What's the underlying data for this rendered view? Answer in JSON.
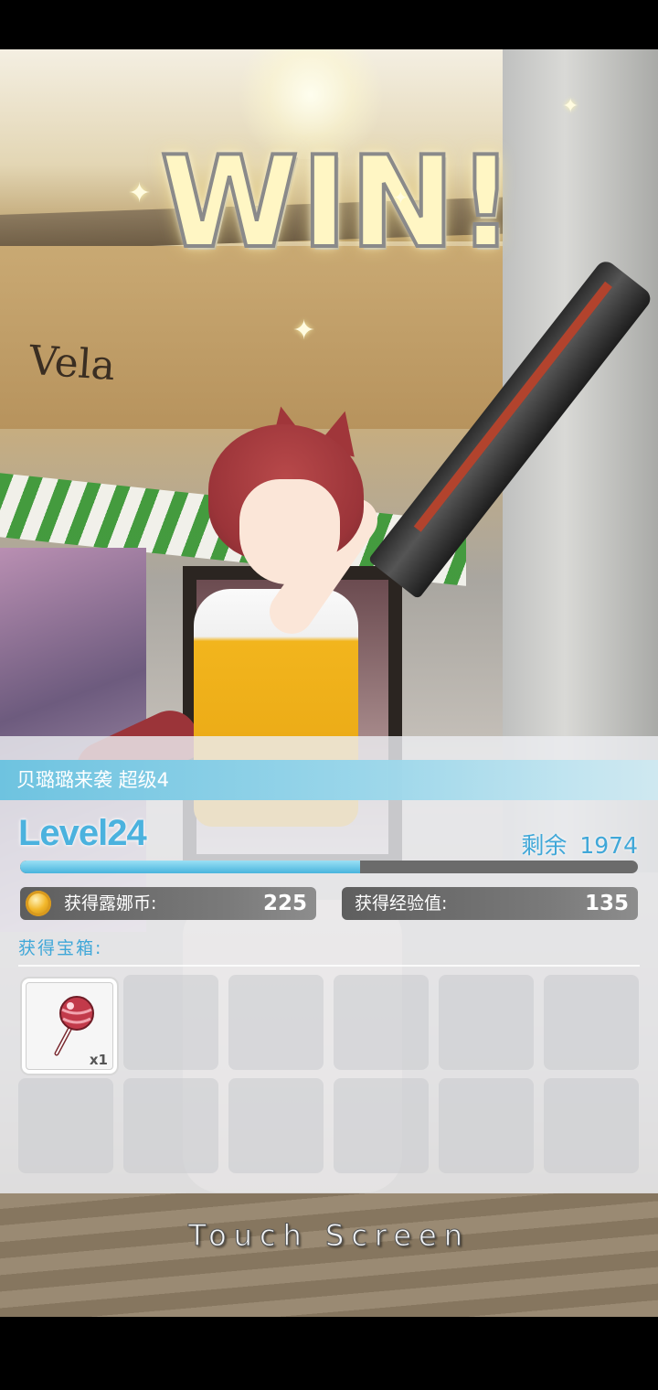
{
  "scene": {
    "win_text": "WIN!",
    "store_sign": "Vela"
  },
  "result": {
    "stage_title": "贝璐璐来袭 超级4",
    "level": "Level24",
    "remaining_label": "剩余",
    "remaining_value": "1974",
    "exp_progress": 0.55,
    "coins_label": "获得露娜币:",
    "coins_value": "225",
    "exp_label": "获得经验值:",
    "exp_value": "135",
    "chest_label": "获得宝箱:",
    "slots": [
      {
        "filled": true,
        "icon": "lollipop-icon",
        "qty": "x1"
      },
      {
        "filled": false
      },
      {
        "filled": false
      },
      {
        "filled": false
      },
      {
        "filled": false
      },
      {
        "filled": false
      },
      {
        "filled": false
      },
      {
        "filled": false
      },
      {
        "filled": false
      },
      {
        "filled": false
      },
      {
        "filled": false
      },
      {
        "filled": false
      }
    ]
  },
  "prompt": {
    "touch_screen": "Touch Screen"
  },
  "colors": {
    "accent_blue": "#3fa7d8",
    "banner_blue": "#6ec3e0",
    "stat_gray": "#6b6b6b"
  }
}
